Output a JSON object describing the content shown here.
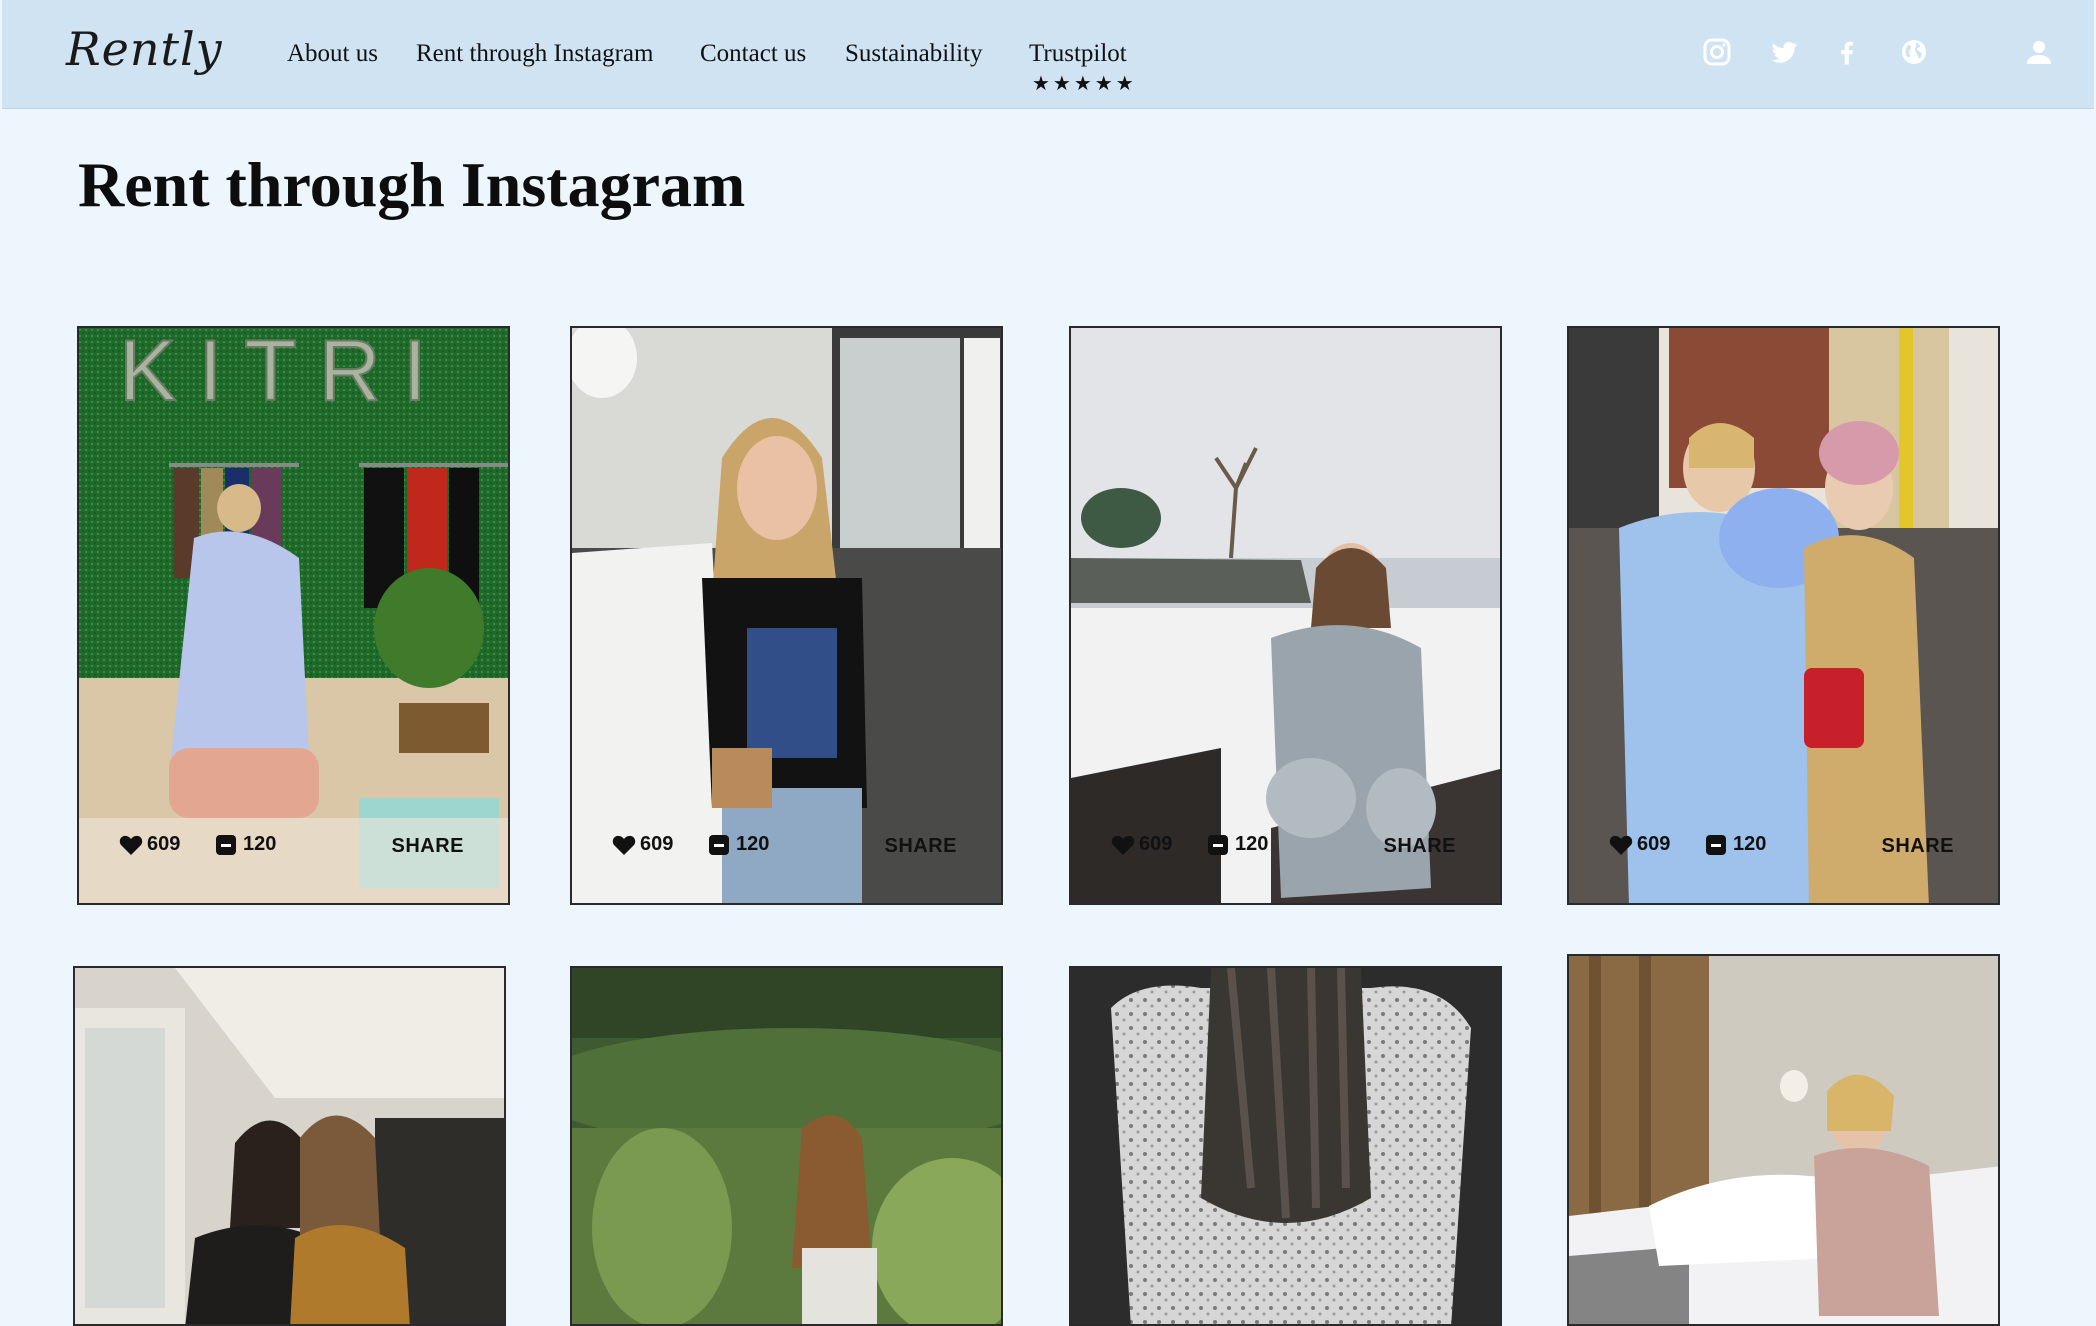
{
  "brand": {
    "logo_text": "Rently"
  },
  "nav": {
    "items": [
      {
        "label": "About us"
      },
      {
        "label": "Rent through Instagram"
      },
      {
        "label": "Contact us"
      },
      {
        "label": "Sustainability"
      },
      {
        "label": "Trustpilot"
      }
    ],
    "trustpilot_rating": "★★★★★"
  },
  "social_icons": [
    "instagram-icon",
    "twitter-icon",
    "facebook-icon",
    "globe-icon",
    "user-icon"
  ],
  "page": {
    "title": "Rent through Instagram"
  },
  "posts": [
    {
      "likes": "609",
      "comments": "120",
      "share_label": "SHARE"
    },
    {
      "likes": "609",
      "comments": "120",
      "share_label": "SHARE"
    },
    {
      "likes": "609",
      "comments": "120",
      "share_label": "SHARE"
    },
    {
      "likes": "609",
      "comments": "120",
      "share_label": "SHARE"
    }
  ],
  "colors": {
    "header_bg": "#cfe3f3",
    "page_bg": "#eef6fd",
    "text": "#111111"
  }
}
